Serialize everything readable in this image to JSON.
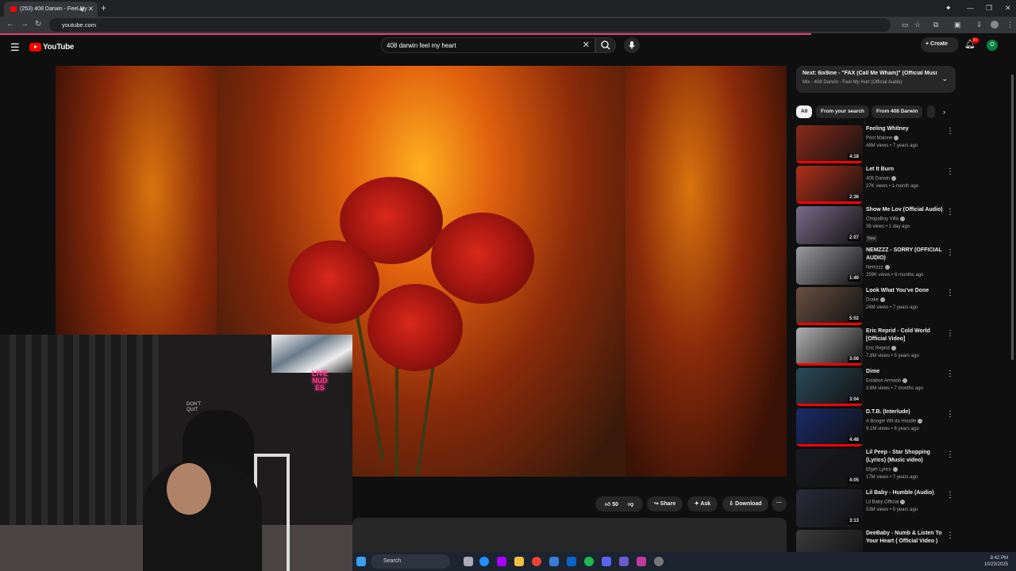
{
  "browser": {
    "tab_title": "(253) 408 Darwin - Feel My",
    "url": "youtube.com"
  },
  "youtube": {
    "logo_text": "YouTube",
    "search_query": "408 darwin feel my heart",
    "create_label": "Create",
    "notifications_badge": "9+",
    "avatar_initial": "O"
  },
  "actions": {
    "like_count": "50",
    "share_label": "Share",
    "ask_label": "Ask",
    "download_label": "Download"
  },
  "next_up": {
    "title": "Next: 6ix9ine - \"FAX (Call Me Wham)\" (Official Musi...",
    "subtitle": "Mix - 408 Darwin - Feel My Hurt (Official Audio)"
  },
  "chips": [
    "All",
    "From your search",
    "From 408 Darwin"
  ],
  "videos": [
    {
      "title": "Feeling Whitney",
      "channel": "Post Malone",
      "meta": "48M views • 7 years ago",
      "duration": "4:18",
      "progress": 1.0,
      "thumb_color": "#8a2a1a"
    },
    {
      "title": "Let It Burn",
      "channel": "408 Darwin",
      "meta": "27K views • 1 month ago",
      "duration": "2:36",
      "progress": 1.0,
      "thumb_color": "#b0301a"
    },
    {
      "title": "Show Me Lov (Official Audio)",
      "channel": "ChopaBoy Villa",
      "meta": "39 views • 1 day ago",
      "duration": "2:07",
      "badge": "New",
      "progress": 0.0,
      "thumb_color": "#7a6a88"
    },
    {
      "title": "NEMZZZ - SORRY (OFFICIAL AUDIO)",
      "channel": "Nemzzz",
      "meta": "259K views • 6 months ago",
      "duration": "1:40",
      "progress": 0.0,
      "thumb_color": "#9a9aa0"
    },
    {
      "title": "Look What You've Done",
      "channel": "Drake",
      "meta": "24M views • 7 years ago",
      "duration": "5:02",
      "progress": 1.0,
      "thumb_color": "#6a5040"
    },
    {
      "title": "Eric Reprid - Cold World [Official Video]",
      "channel": "Eric Reprid",
      "meta": "7.8M views • 5 years ago",
      "duration": "3:00",
      "progress": 1.0,
      "thumb_color": "#b0b0b0"
    },
    {
      "title": "Dime",
      "channel": "Eslabon Armado",
      "meta": "3.8M views • 7 months ago",
      "duration": "3:04",
      "progress": 1.0,
      "thumb_color": "#2a4a5a"
    },
    {
      "title": "D.T.B. (Interlude)",
      "channel": "A Boogie Wit da Hoodie",
      "meta": "9.1M views • 8 years ago",
      "duration": "4:48",
      "progress": 1.0,
      "thumb_color": "#1a2a6a"
    },
    {
      "title": "Lil Peep - Star Shopping (Lyrics) (Music video)",
      "channel": "Elijah Lyrics",
      "meta": "17M views • 7 years ago",
      "duration": "4:05",
      "progress": 0.0,
      "thumb_color": "#1a1a22"
    },
    {
      "title": "Lil Baby - Humble (Audio)",
      "channel": "Lil Baby Official",
      "meta": "53M views • 5 years ago",
      "duration": "3:13",
      "progress": 0.0,
      "thumb_color": "#2a2a3a"
    },
    {
      "title": "DeeBaby - Numb & Listen To Your Heart ( Official Video )",
      "channel": "",
      "meta": "",
      "duration": "",
      "progress": 0.0,
      "thumb_color": "#3a3a3a"
    }
  ],
  "webcam": {
    "neon_text": "LIVE NUDES",
    "sign_text": "DON'T QUIT"
  },
  "taskbar": {
    "search_label": "Search",
    "time": "8:42 PM",
    "date": "10/23/2025"
  }
}
